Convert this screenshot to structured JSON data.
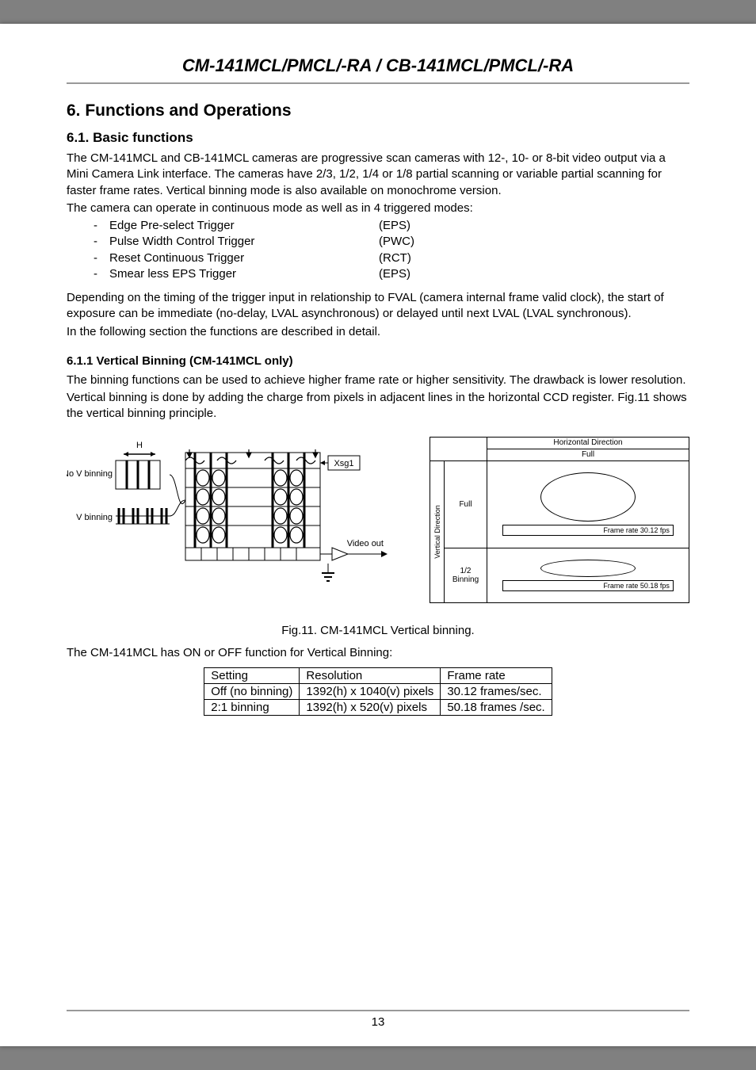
{
  "header": {
    "title": "CM-141MCL/PMCL/-RA / CB-141MCL/PMCL/-RA"
  },
  "section": {
    "number_title": "6.   Functions and Operations"
  },
  "subsection": {
    "number_title": "6.1.   Basic functions",
    "para1": "The CM-141MCL and CB-141MCL cameras are progressive scan cameras with 12-, 10- or 8-bit video output via a Mini Camera Link interface. The cameras have 2/3, 1/2, 1/4 or 1/8 partial scanning or variable partial scanning for faster frame rates. Vertical binning mode is also available on monochrome version.",
    "para2": "The camera can operate in continuous mode as well as in 4 triggered modes:",
    "modes": [
      {
        "name": "Edge Pre-select Trigger",
        "code": "(EPS)"
      },
      {
        "name": "Pulse Width Control Trigger",
        "code": "(PWC)"
      },
      {
        "name": "Reset Continuous Trigger",
        "code": "(RCT)"
      },
      {
        "name": "Smear less EPS Trigger",
        "code": "(EPS)"
      }
    ],
    "para3": "Depending on the timing of the trigger input in relationship to FVAL (camera internal frame valid clock), the start of exposure can be immediate (no-delay, LVAL asynchronous) or delayed until next LVAL (LVAL synchronous).",
    "para4": "In the following section the functions are described in detail."
  },
  "subsubsection": {
    "number_title": "6.1.1   Vertical Binning (CM-141MCL only)",
    "para1": "The binning functions can be used to achieve higher frame rate or higher sensitivity. The drawback is lower resolution.",
    "para2": "Vertical binning is done by adding the charge from pixels in adjacent lines in the horizontal CCD register. Fig.11 shows the vertical binning principle."
  },
  "diagram_left": {
    "h_label": "H",
    "no_v_binning": "No V binning",
    "v_binning": "V binning",
    "xsg1": "Xsg1",
    "video_out": "Video out"
  },
  "diagram_right": {
    "horizontal_direction": "Horizontal Direction",
    "full_top": "Full",
    "vertical_direction": "Vertical Direction",
    "row1_label": "Full",
    "row1_frame": "Frame rate  30.12 fps",
    "row2_label": "1/2 Binning",
    "row2_frame": "Frame rate 50.18 fps"
  },
  "figure_caption": "Fig.11.   CM-141MCL Vertical binning.",
  "after_figure": "The CM-141MCL has ON or OFF function for Vertical Binning:",
  "binning_table": {
    "headers": [
      "Setting",
      "Resolution",
      "Frame rate"
    ],
    "rows": [
      [
        "Off (no binning)",
        "1392(h) x 1040(v) pixels",
        "30.12 frames/sec."
      ],
      [
        "2:1 binning",
        "1392(h) x 520(v) pixels",
        "50.18 frames /sec."
      ]
    ]
  },
  "page_number": "13"
}
